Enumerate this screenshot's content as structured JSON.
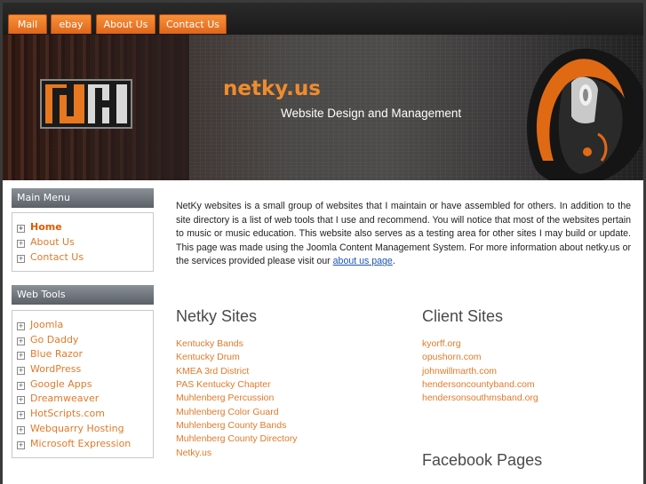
{
  "nav": {
    "tabs": [
      {
        "label": "Mail"
      },
      {
        "label": "ebay"
      },
      {
        "label": "About Us"
      },
      {
        "label": "Contact Us"
      }
    ]
  },
  "banner": {
    "title": "netky.us",
    "subtitle": "Website Design and Management"
  },
  "sidebar": {
    "main_menu": {
      "title": "Main Menu",
      "items": [
        {
          "label": "Home"
        },
        {
          "label": "About Us"
        },
        {
          "label": "Contact Us"
        }
      ]
    },
    "web_tools": {
      "title": "Web Tools",
      "items": [
        {
          "label": "Joomla"
        },
        {
          "label": "Go Daddy"
        },
        {
          "label": "Blue Razor"
        },
        {
          "label": "WordPress"
        },
        {
          "label": "Google Apps"
        },
        {
          "label": "Dreamweaver"
        },
        {
          "label": "HotScripts.com"
        },
        {
          "label": "Webquarry Hosting"
        },
        {
          "label": "Microsoft Expression"
        }
      ]
    }
  },
  "content": {
    "intro_text": "NetKy websites is a small group of websites that I maintain or have assembled for others.  In addition to the site directory is a list of web tools that I use and recommend.  You will notice that most of the websites pertain to music or music education.  This website also serves as a testing area for other sites I may build or update.  This page was made using the Joomla Content Management System.  For more information about netky.us or the services provided please visit our ",
    "intro_link": "about us page",
    "intro_end": ".",
    "netky_sites": {
      "title": "Netky Sites",
      "links": [
        {
          "label": "Kentucky Bands"
        },
        {
          "label": "Kentucky Drum"
        },
        {
          "label": "KMEA 3rd District"
        },
        {
          "label": "PAS Kentucky Chapter"
        },
        {
          "label": "Muhlenberg Percussion"
        },
        {
          "label": "Muhlenberg Color Guard"
        },
        {
          "label": "Muhlenberg County Bands"
        },
        {
          "label": "Muhlenberg County Directory"
        },
        {
          "label": "Netky.us"
        }
      ]
    },
    "client_sites": {
      "title": "Client Sites",
      "links": [
        {
          "label": "kyorff.org"
        },
        {
          "label": "opushorn.com"
        },
        {
          "label": "johnwillmarth.com"
        },
        {
          "label": "hendersoncountyband.com"
        },
        {
          "label": "hendersonsouthmsband.org"
        }
      ]
    },
    "facebook": {
      "title": "Facebook Pages"
    }
  },
  "colors": {
    "accent": "#f08c2c",
    "link": "#e07a2a",
    "header_gray": "#6a7076"
  }
}
